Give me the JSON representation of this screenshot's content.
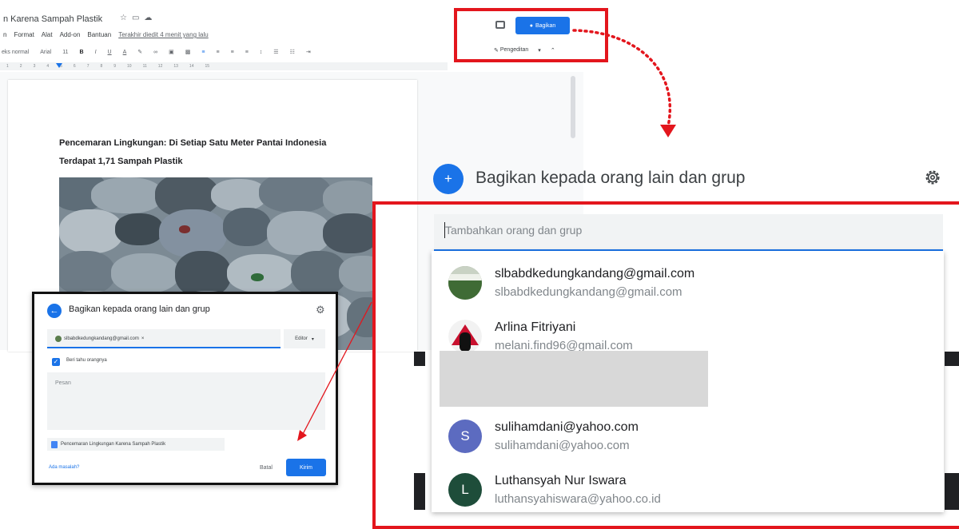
{
  "docs": {
    "title": "n Karena Sampah Plastik",
    "menu": [
      "n",
      "Format",
      "Alat",
      "Add-on",
      "Bantuan"
    ],
    "last_edit": "Terakhir diedit 4 menit yang lalu",
    "toolbar": {
      "style": "eks normal",
      "font": "Arial",
      "size": "11",
      "bold": "B",
      "italic": "I",
      "underline": "U",
      "textcolor": "A"
    },
    "share_label": "Bagikan",
    "edit_mode": "Pengeditan",
    "heading_line1": "Pencemaran Lingkungan: Di Setiap Satu Meter Pantai Indonesia",
    "heading_line2": "Terdapat 1,71 Sampah Plastik"
  },
  "small_dialog": {
    "title": "Bagikan kepada orang lain dan grup",
    "chip": "slbabdkedungkandang@gmail.com",
    "role": "Editor",
    "notify": "Beri tahu orangnya",
    "message_placeholder": "Pesan",
    "attachment": "Pencemaran Lingkungan Karena Sampah Plastik",
    "link": "Ada masalah?",
    "cancel": "Batal",
    "send": "Kirim"
  },
  "big_dialog": {
    "title": "Bagikan kepada orang lain dan grup",
    "placeholder": "Tambahkan orang dan grup",
    "suggestions": [
      {
        "name": "slbabdkedungkandang@gmail.com",
        "email": "slbabdkedungkandang@gmail.com",
        "avatar": "photo"
      },
      {
        "name": "Arlina Fitriyani",
        "email": "melani.find96@gmail.com",
        "avatar": "photo"
      },
      {
        "name": "sulihamdani@yahoo.com",
        "email": "sulihamdani@yahoo.com",
        "avatar_letter": "S",
        "avatar_color": "#5c6bc0"
      },
      {
        "name": "Luthansyah Nur Iswara",
        "email": "luthansyahiswara@yahoo.co.id",
        "avatar_letter": "L",
        "avatar_color": "#1e4d3a"
      }
    ]
  },
  "colors": {
    "accent": "#1a73e8",
    "highlight": "#e3161d"
  }
}
